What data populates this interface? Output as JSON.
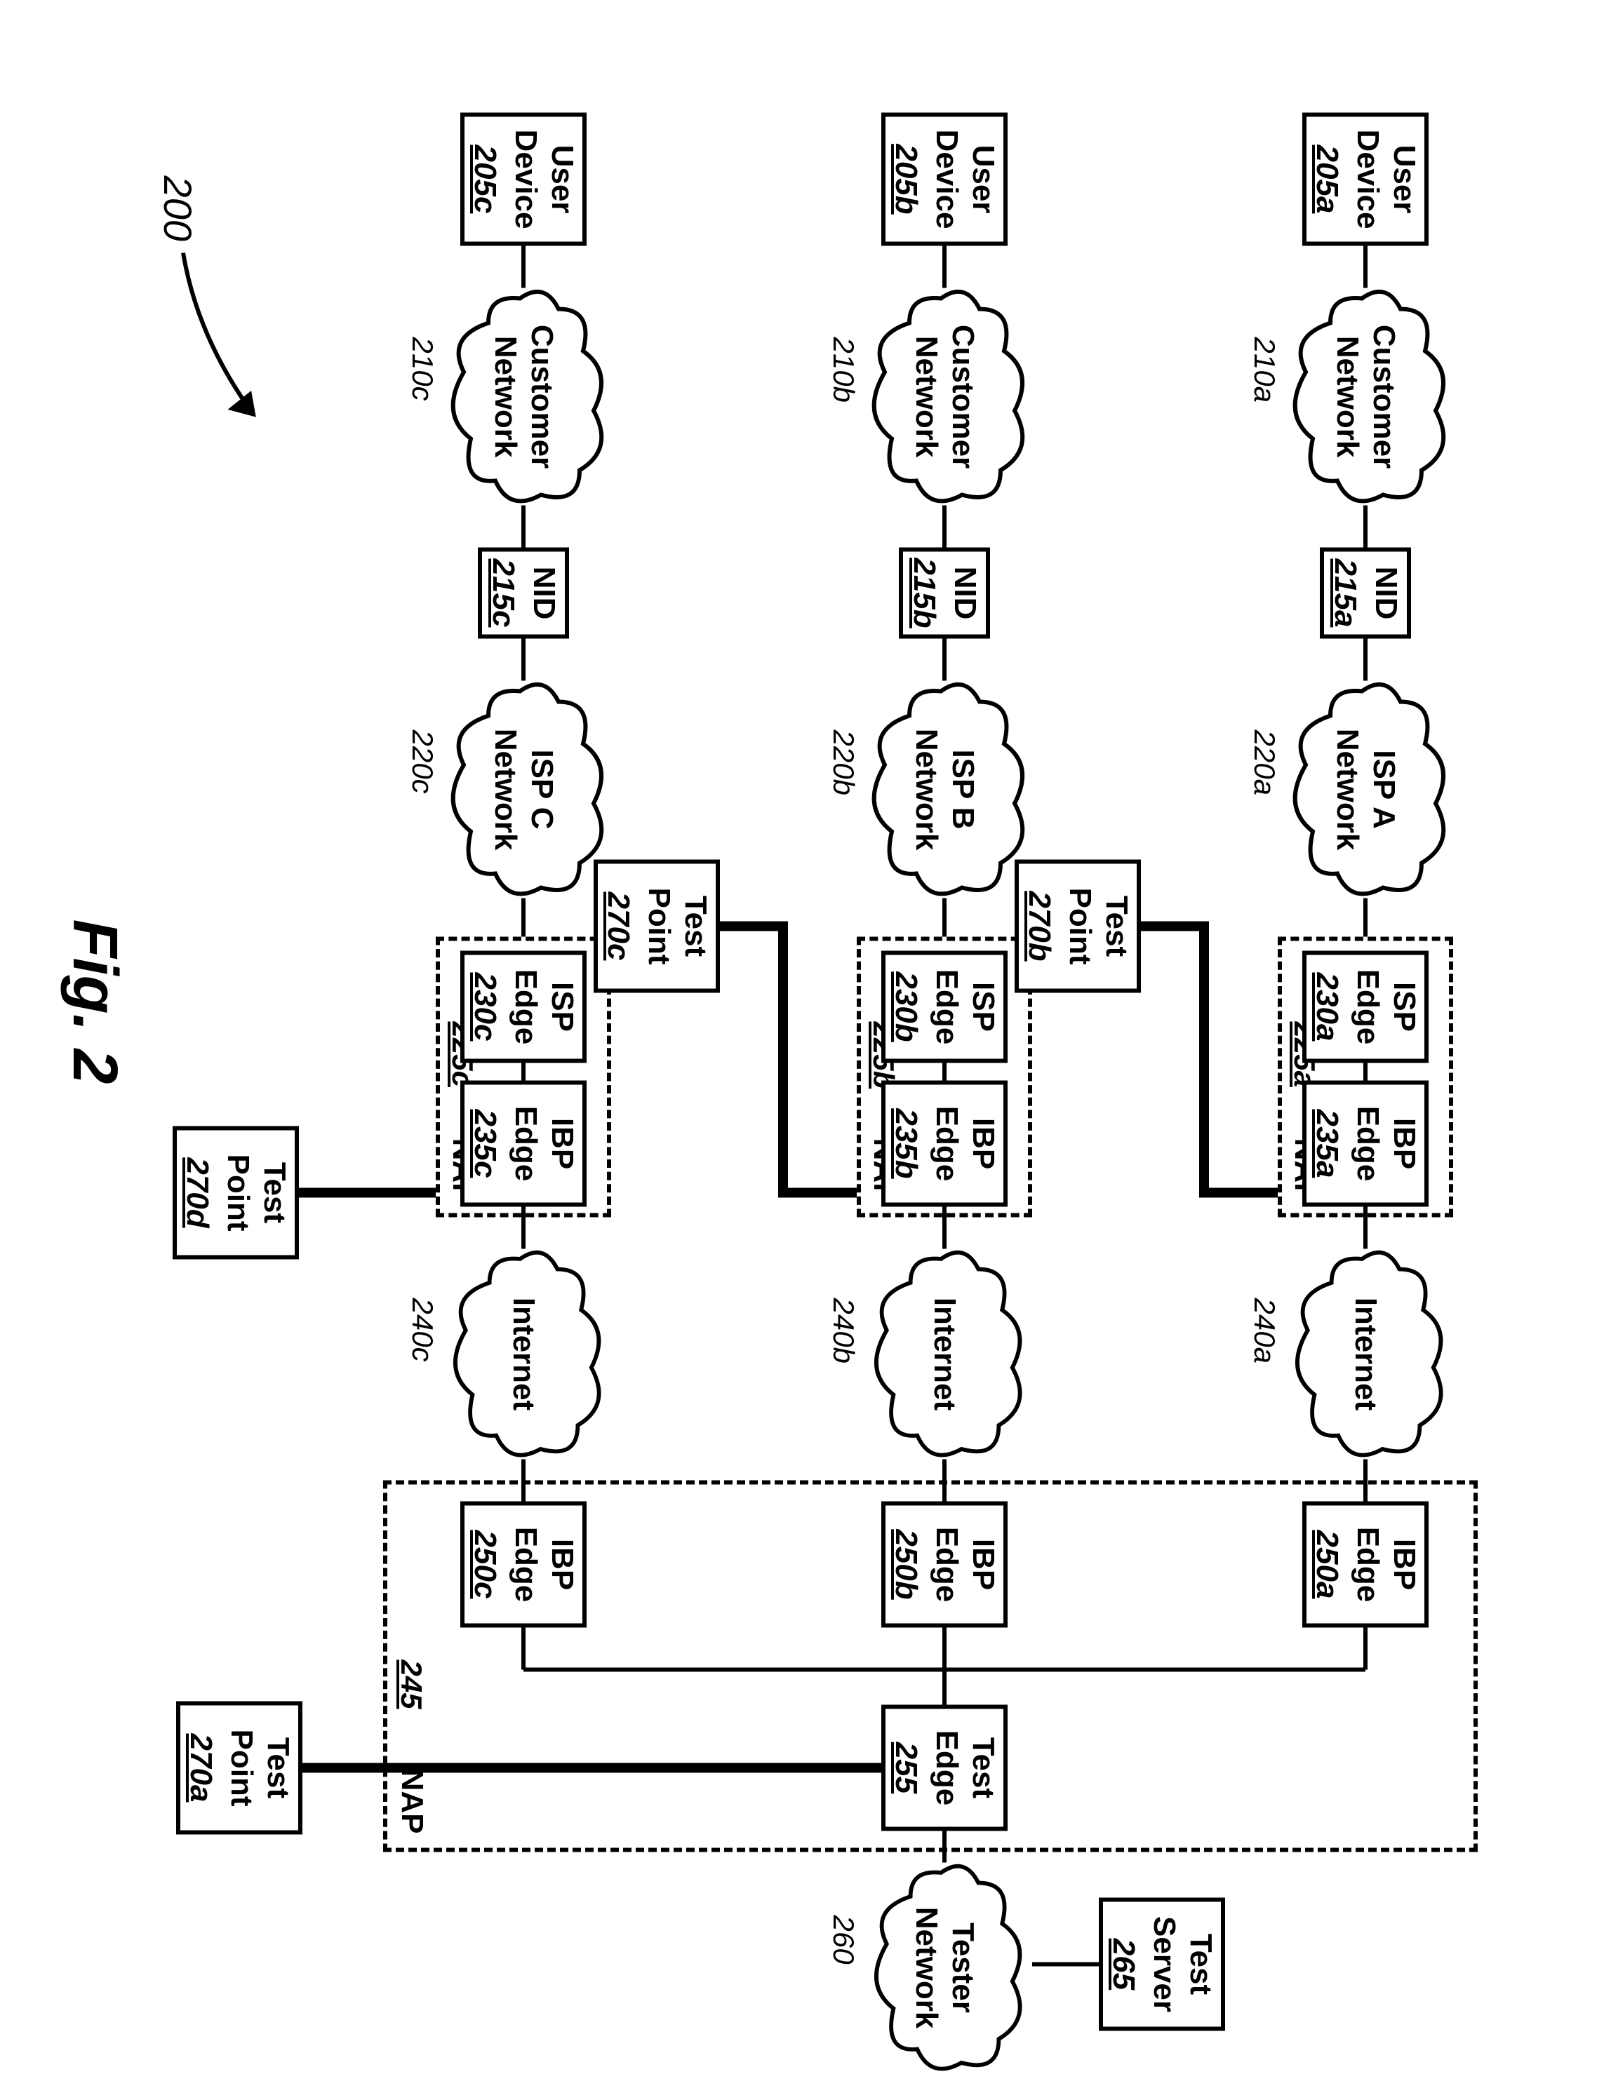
{
  "figure": {
    "number_ref": "200",
    "caption": "Fig. 2"
  },
  "rows": {
    "a": {
      "user": {
        "l1": "User",
        "l2": "Device",
        "ref": "205a"
      },
      "cust": {
        "l1": "Customer",
        "l2": "Network",
        "ref": "210a"
      },
      "nid": {
        "l1": "NID",
        "ref": "215a"
      },
      "isp": {
        "l1": "ISP A",
        "l2": "Network",
        "ref": "220a"
      },
      "nap": {
        "label": "NAP",
        "ref": "225a"
      },
      "ispedge": {
        "l1": "ISP",
        "l2": "Edge",
        "ref": "230a"
      },
      "ibpedgeL": {
        "l1": "IBP",
        "l2": "Edge",
        "ref": "235a"
      },
      "internet": {
        "l1": "Internet",
        "ref": "240a"
      },
      "ibpedgeR": {
        "l1": "IBP",
        "l2": "Edge",
        "ref": "250a"
      }
    },
    "b": {
      "user": {
        "l1": "User",
        "l2": "Device",
        "ref": "205b"
      },
      "cust": {
        "l1": "Customer",
        "l2": "Network",
        "ref": "210b"
      },
      "nid": {
        "l1": "NID",
        "ref": "215b"
      },
      "isp": {
        "l1": "ISP B",
        "l2": "Network",
        "ref": "220b"
      },
      "nap": {
        "label": "NAP",
        "ref": "225b"
      },
      "ispedge": {
        "l1": "ISP",
        "l2": "Edge",
        "ref": "230b"
      },
      "ibpedgeL": {
        "l1": "IBP",
        "l2": "Edge",
        "ref": "235b"
      },
      "internet": {
        "l1": "Internet",
        "ref": "240b"
      },
      "ibpedgeR": {
        "l1": "IBP",
        "l2": "Edge",
        "ref": "250b"
      }
    },
    "c": {
      "user": {
        "l1": "User",
        "l2": "Device",
        "ref": "205c"
      },
      "cust": {
        "l1": "Customer",
        "l2": "Network",
        "ref": "210c"
      },
      "nid": {
        "l1": "NID",
        "ref": "215c"
      },
      "isp": {
        "l1": "ISP C",
        "l2": "Network",
        "ref": "220c"
      },
      "nap": {
        "label": "NAP",
        "ref": "225c"
      },
      "ispedge": {
        "l1": "ISP",
        "l2": "Edge",
        "ref": "230c"
      },
      "ibpedgeL": {
        "l1": "IBP",
        "l2": "Edge",
        "ref": "235c"
      },
      "internet": {
        "l1": "Internet",
        "ref": "240c"
      },
      "ibpedgeR": {
        "l1": "IBP",
        "l2": "Edge",
        "ref": "250c"
      }
    }
  },
  "right_nap": {
    "label": "NAP",
    "ref": "245"
  },
  "test_edge": {
    "l1": "Test",
    "l2": "Edge",
    "ref": "255"
  },
  "tester_net": {
    "l1": "Tester",
    "l2": "Network",
    "ref": "260"
  },
  "test_server": {
    "l1": "Test",
    "l2": "Server",
    "ref": "265"
  },
  "test_points": {
    "a": {
      "l1": "Test",
      "l2": "Point",
      "ref": "270a"
    },
    "b": {
      "l1": "Test",
      "l2": "Point",
      "ref": "270b"
    },
    "c": {
      "l1": "Test",
      "l2": "Point",
      "ref": "270c"
    },
    "d": {
      "l1": "Test",
      "l2": "Point",
      "ref": "270d"
    }
  }
}
